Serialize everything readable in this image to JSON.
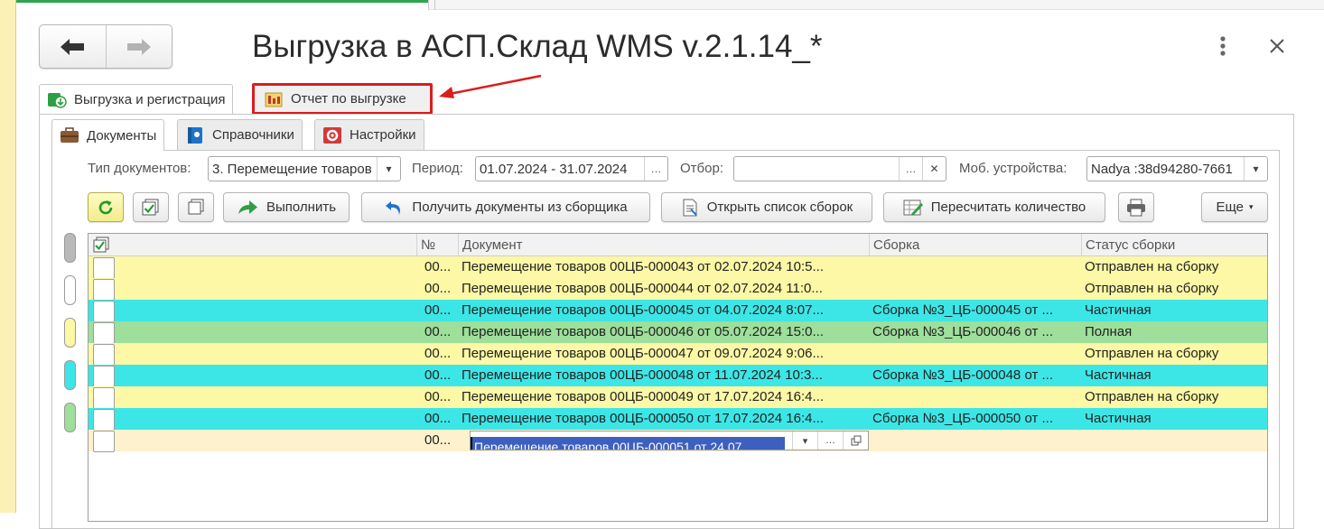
{
  "window": {
    "title": "Выгрузка в АСП.Склад WMS v.2.1.14_*"
  },
  "top_tabs": [
    {
      "label": "Выгрузка и регистрация"
    },
    {
      "label": "Отчет по выгрузке"
    }
  ],
  "sub_tabs": [
    {
      "label": "Документы"
    },
    {
      "label": "Справочники"
    },
    {
      "label": "Настройки"
    }
  ],
  "filters": {
    "doc_type_label": "Тип документов:",
    "doc_type_value": "3. Перемещение товаров",
    "period_label": "Период:",
    "period_value": "01.07.2024 - 31.07.2024",
    "selection_label": "Отбор:",
    "selection_value": "",
    "devices_label": "Моб. устройства:",
    "devices_value": "Nadya :38d94280-7661"
  },
  "toolbar": {
    "execute": "Выполнить",
    "get_docs": "Получить документы из сборщика",
    "open_list": "Открыть список сборок",
    "recalc": "Пересчитать количество",
    "more": "Еще"
  },
  "grid": {
    "columns": [
      "№",
      "Документ",
      "Сборка",
      "Статус сборки"
    ],
    "rows": [
      {
        "num": "00...",
        "document": "Перемещение товаров 00ЦБ-000043 от 02.07.2024 10:5...",
        "assembly": "",
        "status": "Отправлен на сборку",
        "color": "#fcf8a5"
      },
      {
        "num": "00...",
        "document": "Перемещение товаров 00ЦБ-000044 от 02.07.2024 11:0...",
        "assembly": "",
        "status": "Отправлен на сборку",
        "color": "#fcf8a5"
      },
      {
        "num": "00...",
        "document": "Перемещение товаров 00ЦБ-000045 от 04.07.2024 8:07...",
        "assembly": "Сборка №3_ЦБ-000045 от ...",
        "status": "Частичная",
        "color": "#3de6e6"
      },
      {
        "num": "00...",
        "document": "Перемещение товаров 00ЦБ-000046 от 05.07.2024 15:0...",
        "assembly": "Сборка №3_ЦБ-000046 от ...",
        "status": "Полная",
        "color": "#9ddf9b"
      },
      {
        "num": "00...",
        "document": "Перемещение товаров 00ЦБ-000047 от 09.07.2024 9:06...",
        "assembly": "",
        "status": "Отправлен на сборку",
        "color": "#fcf8a5"
      },
      {
        "num": "00...",
        "document": "Перемещение товаров 00ЦБ-000048 от 11.07.2024 10:3...",
        "assembly": "Сборка №3_ЦБ-000048 от ...",
        "status": "Частичная",
        "color": "#3de6e6"
      },
      {
        "num": "00...",
        "document": "Перемещение товаров 00ЦБ-000049 от 17.07.2024 16:4...",
        "assembly": "",
        "status": "Отправлен на сборку",
        "color": "#fcf8a5"
      },
      {
        "num": "00...",
        "document": "Перемещение товаров 00ЦБ-000050 от 17.07.2024 16:4...",
        "assembly": "Сборка №3_ЦБ-000050 от ...",
        "status": "Частичная",
        "color": "#3de6e6"
      }
    ],
    "edit_row": {
      "num": "00...",
      "document_editing": "Перемещение товаров 00ЦБ-000051 от 24.07.",
      "color": "#fdf2cd"
    }
  },
  "side_colors": [
    "#b9b9b9",
    "#ffffff",
    "#fcf8a5",
    "#3de6e6",
    "#9ddf9b"
  ],
  "colors": {
    "annotation_red": "#d91e1e",
    "yellow_row": "#fcf8a5",
    "cyan_row": "#3de6e6",
    "green_row": "#9ddf9b"
  }
}
